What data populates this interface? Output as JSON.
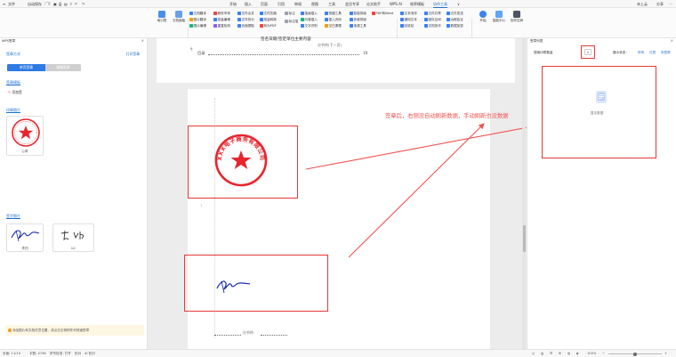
{
  "titlebar": {
    "file_menu": "文件",
    "autosave": "自动保存",
    "tabs": [
      "开始",
      "插入",
      "页面",
      "引用",
      "审阅",
      "视图",
      "工具",
      "会员专享",
      "论文助手",
      "WPS AI",
      "效率模板",
      "协作工具"
    ],
    "active_tab": "协作工具",
    "share": "分享",
    "user": "未上云"
  },
  "ribbon": {
    "big_buttons": [
      "索引表",
      "文档面板"
    ],
    "col_a": [
      "文档翻译",
      "图片翻译",
      "图片编辑"
    ],
    "col_b": [
      "服务市场",
      "批量编辑",
      "重复检测"
    ],
    "col_c": [
      "文件合并",
      "文件拆分",
      "页面提取"
    ],
    "col_d": [
      "文件压缩",
      "批量转换",
      "转为PDF"
    ],
    "mid_a": [
      "标注",
      "标注插"
    ],
    "col_e": [
      "插画插入",
      "问卷插入",
      "文字识别"
    ],
    "col_f": [
      "快捷工具",
      "插入页码",
      "空白清理"
    ],
    "col_g": [
      "智能排版",
      "多维排版",
      "电源工具"
    ],
    "pdf": "PDF转Word",
    "col_h": [
      "文本流传",
      "通知文本",
      "回收站"
    ],
    "col_i": [
      "文件共享",
      "团队空间",
      "文档协作"
    ],
    "col_j": [
      "文件发送",
      "远程会议",
      "数据加密"
    ],
    "right_btns": [
      "开始",
      "智能中心",
      "协作空间"
    ],
    "groups": [
      "目录",
      "文件处理",
      "工具",
      "论文",
      "文档处理",
      "联系",
      "开发"
    ]
  },
  "left_panel": {
    "header": "WPS签章",
    "section_mode": "签章方式",
    "section_mode_link": "打印签章",
    "seg_on": "单页签章",
    "seg_off": "骑缝签章",
    "section_template": "签章模板",
    "upload": "添加签",
    "section_seal": "印章图片",
    "seal_label": "公章",
    "section_signature": "签字图片",
    "sig1_label": "李四",
    "sig2_label": "b2",
    "tip": "添加图片和文档任意位置，或点击右侧附件列快速签章"
  },
  "document": {
    "line_top": "签名日期/签定单位主要内容",
    "footnote_top": "分节符(下一页)",
    "toc_line": "目录",
    "toc_page": "10",
    "footnote_bottom": "分节符",
    "annotation": "签章后，右侧没自动刷新数据，手动刷新也没数据",
    "seal_text": "XXX电子商务有限公司"
  },
  "right_panel": {
    "header": "签章列表",
    "search_label": "搜索印章数量",
    "status_label": "展示状态：",
    "filter_all": "所有",
    "filter_done": "已签",
    "filter_undone": "未签章",
    "empty": "暂无数据"
  },
  "statusbar": {
    "page": "页面: 11/14",
    "words": "字数: 4746",
    "spell": "拼写检查: 打开",
    "proof": "校对",
    "ai": "AI 校对",
    "zoom": "100%"
  },
  "colors": {
    "accent": "#1f6fd0",
    "seal_red": "#e8242c",
    "annotation_red": "#ef5350",
    "signature_blue": "#1a2da8"
  }
}
